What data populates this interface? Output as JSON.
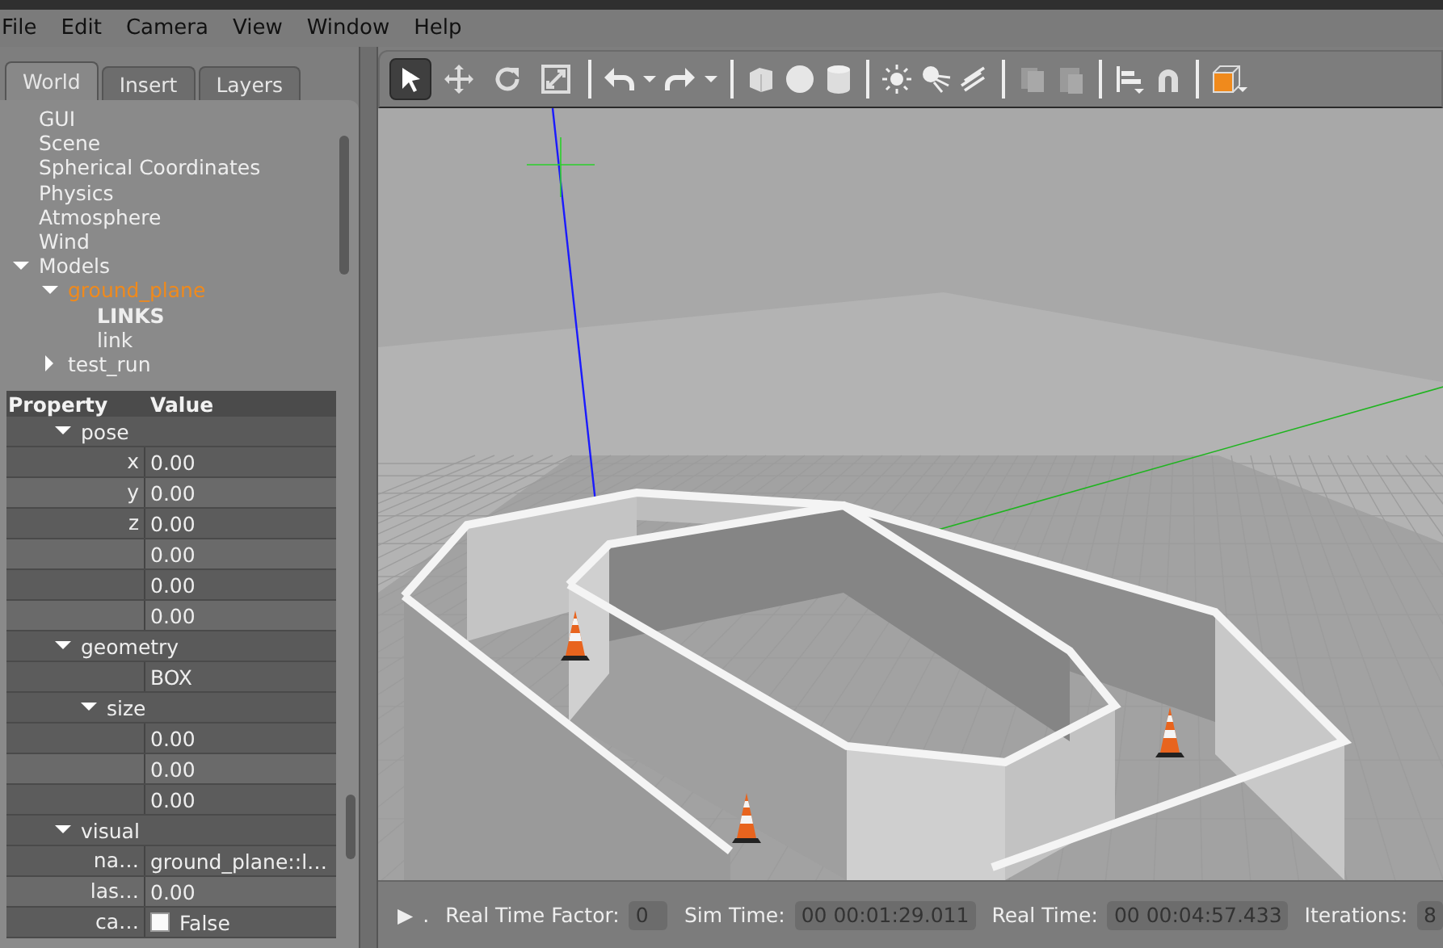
{
  "menu": [
    "File",
    "Edit",
    "Camera",
    "View",
    "Window",
    "Help"
  ],
  "tabs": [
    {
      "label": "World",
      "selected": true
    },
    {
      "label": "Insert",
      "selected": false
    },
    {
      "label": "Layers",
      "selected": false
    }
  ],
  "tree": [
    {
      "label": "GUI",
      "kind": "item",
      "selected": false
    },
    {
      "label": "Scene",
      "kind": "item",
      "selected": false
    },
    {
      "label": "Spherical Coordinates",
      "kind": "item",
      "selected": false
    },
    {
      "label": "Physics",
      "kind": "item",
      "selected": false
    },
    {
      "label": "Atmosphere",
      "kind": "item",
      "selected": false
    },
    {
      "label": "Wind",
      "kind": "item",
      "selected": false
    },
    {
      "label": "Models",
      "kind": "item",
      "selected": false,
      "expanded": true,
      "children": [
        {
          "label": "ground_plane",
          "kind": "item",
          "selected": true,
          "expanded": true,
          "children": [
            {
              "label": "LINKS",
              "kind": "header",
              "selected": false
            },
            {
              "label": "link",
              "kind": "item",
              "selected": false
            }
          ]
        },
        {
          "label": "test_run",
          "kind": "item",
          "selected": false,
          "expanded": false
        }
      ]
    }
  ],
  "properties": {
    "columns": [
      "Property",
      "Value"
    ],
    "rows": [
      {
        "kind": "group",
        "label": "pose",
        "expanded": true,
        "children": [
          {
            "kind": "field",
            "label": "x",
            "value": "0.00"
          },
          {
            "kind": "field",
            "label": "y",
            "value": "0.00"
          },
          {
            "kind": "field",
            "label": "z",
            "value": "0.00"
          },
          {
            "kind": "field",
            "value": "0.00"
          },
          {
            "kind": "field",
            "value": "0.00"
          },
          {
            "kind": "field",
            "value": "0.00"
          }
        ]
      },
      {
        "kind": "group",
        "label": "geometry",
        "expanded": true,
        "children": [
          {
            "kind": "field",
            "value": "BOX"
          },
          {
            "kind": "group",
            "label": "size",
            "expanded": true,
            "children": [
              {
                "kind": "field",
                "value": "0.00"
              },
              {
                "kind": "field",
                "value": "0.00"
              },
              {
                "kind": "field",
                "value": "0.00"
              }
            ]
          }
        ]
      },
      {
        "kind": "group",
        "label": "visual",
        "expanded": true,
        "children": [
          {
            "kind": "field",
            "label": "na…",
            "value": "ground_plane::l…"
          },
          {
            "kind": "field",
            "label": "las…",
            "value": "0.00"
          },
          {
            "kind": "check",
            "label": "ca…",
            "value": "False",
            "checked": false
          }
        ]
      }
    ]
  },
  "tools": [
    {
      "selected": true
    },
    {
      "selected": false
    },
    {
      "selected": false
    },
    {
      "selected": false
    }
  ],
  "status": {
    "play_symbol": "▶",
    "dot": ".",
    "fields": [
      {
        "label": "Real Time Factor:",
        "value": "0"
      },
      {
        "label": "Sim Time:",
        "value": "00 00:01:29.011"
      },
      {
        "label": "Real Time:",
        "value": "00 00:04:57.433"
      },
      {
        "label": "Iterations:",
        "value": "8"
      }
    ]
  }
}
